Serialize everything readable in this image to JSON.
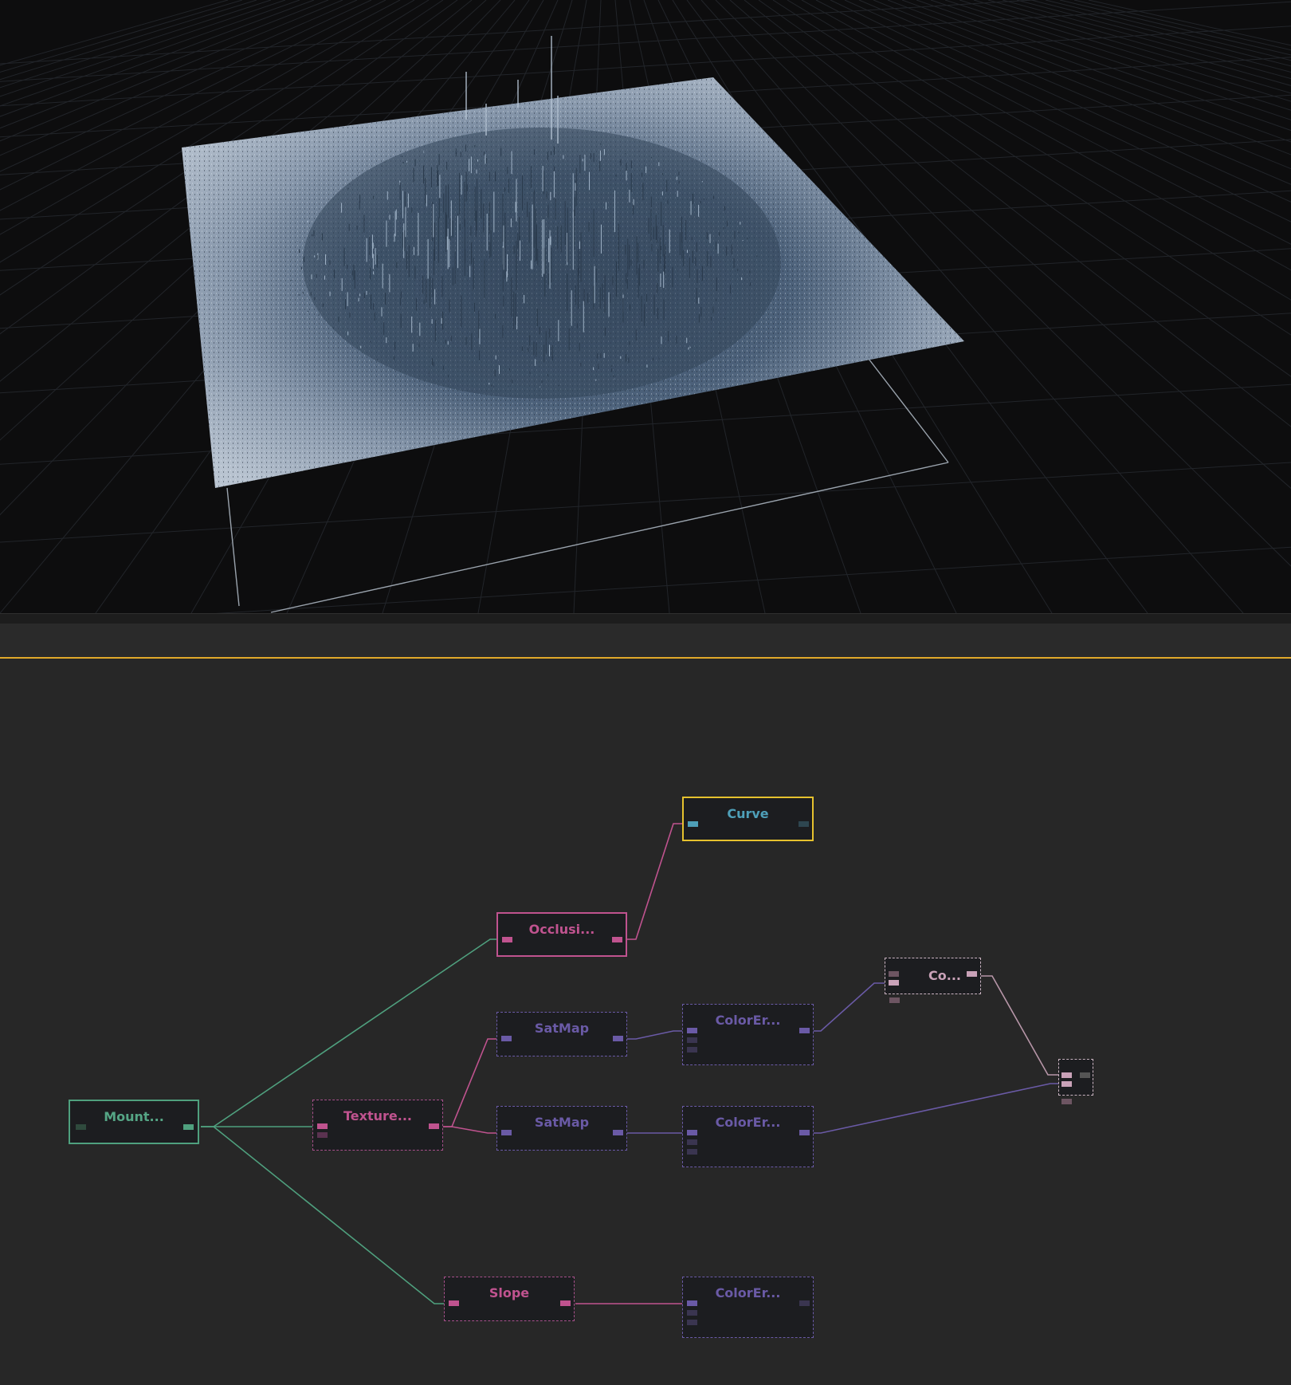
{
  "colors": {
    "terrain_node": "#4fa07e",
    "data_node": "#c0538f",
    "color_node": "#6a5aa6",
    "output_node": "#e6c22e",
    "combine_node": "#b796a8",
    "selection": "#e0a92a"
  },
  "graph": {
    "nodes": [
      {
        "id": "mountain",
        "label": "Mount..."
      },
      {
        "id": "texture",
        "label": "Texture..."
      },
      {
        "id": "occlusion",
        "label": "Occlusi..."
      },
      {
        "id": "curve",
        "label": "Curve"
      },
      {
        "id": "satmap1",
        "label": "SatMap"
      },
      {
        "id": "satmap2",
        "label": "SatMap"
      },
      {
        "id": "colorerode1",
        "label": "ColorEr..."
      },
      {
        "id": "colorerode2",
        "label": "ColorEr..."
      },
      {
        "id": "colorerode3",
        "label": "ColorEr..."
      },
      {
        "id": "slope",
        "label": "Slope"
      },
      {
        "id": "combine",
        "label": "Co..."
      },
      {
        "id": "output",
        "label": ""
      }
    ]
  }
}
